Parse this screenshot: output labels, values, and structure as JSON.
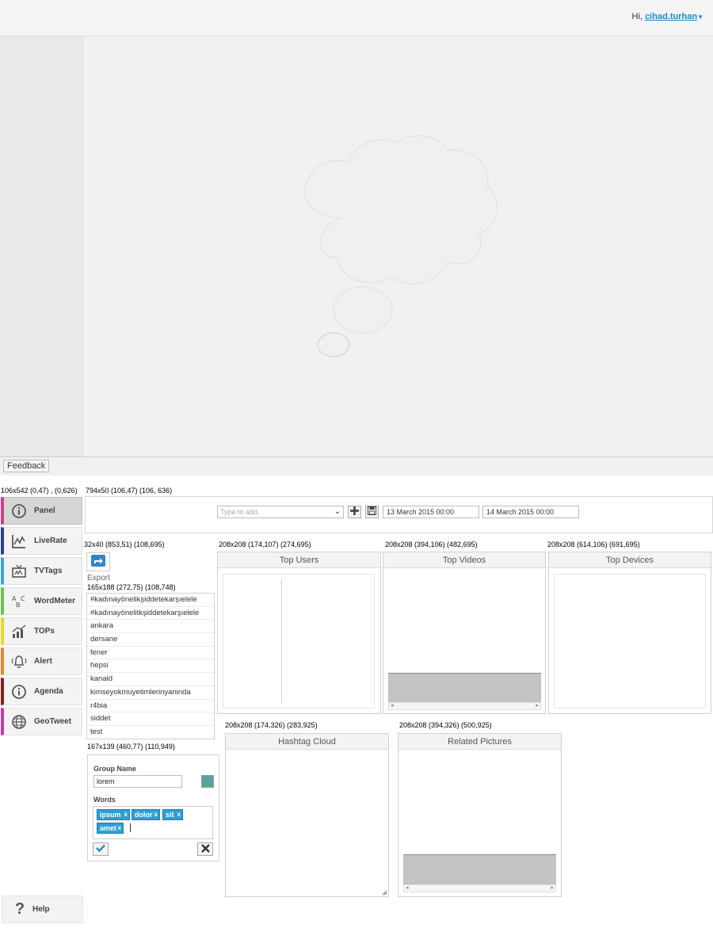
{
  "header": {
    "greeting": "Hi,",
    "username": "cihad.turhan"
  },
  "feedback_label": "Feedback",
  "annotations": {
    "sidebar": "106x542  (0,47) , (0,626)",
    "filterbar": "794x50 (106,47) (106, 636)",
    "export": "32x40 (853,51) (108,695)",
    "top_users": "208x208 (174,107) (274,695)",
    "top_videos": "208x208 (394,106) (482,695)",
    "top_devices": "208x208 (614,106) (691,695)",
    "hashtag_list": "165x188 (272,75) (108,748)",
    "hashtag_cloud": "208x208 (174,326) (283,925)",
    "related_pictures": "208x208 (394,326) (500,925)",
    "group_form": "167x139 (460,77) (110,949)"
  },
  "sidebar": {
    "items": [
      {
        "label": "Panel",
        "icon": "info-circle-icon",
        "color": "#d63c8c"
      },
      {
        "label": "LiveRate",
        "icon": "line-chart-icon",
        "color": "#2c3e8f"
      },
      {
        "label": "TVTags",
        "icon": "tv-icon",
        "color": "#37a8dc"
      },
      {
        "label": "WordMeter",
        "icon": "abc-icon",
        "color": "#6fc04b"
      },
      {
        "label": "TOPs",
        "icon": "bar-chart-icon",
        "color": "#e6d52b"
      },
      {
        "label": "Alert",
        "icon": "bell-icon",
        "color": "#e8872d"
      },
      {
        "label": "Agenda",
        "icon": "info-circle-icon",
        "color": "#8a1d1d"
      },
      {
        "label": "GeoTweet",
        "icon": "globe-icon",
        "color": "#c53a9d"
      }
    ],
    "help_label": "Help"
  },
  "filter": {
    "placeholder": "Type to add.",
    "start_date": "13 March 2015 00:00",
    "end_date": "14 March 2015 00:00"
  },
  "export_label": "Export",
  "hashtags": [
    "#kadınayönelikşiddetekarşıelele",
    "#kadınayönelitkşiddetekarşıelele",
    "ankara",
    "dersane",
    "fener",
    "hepsi",
    "kanald",
    "kimseyokmuyetimlerinyaninda",
    "r4bia",
    "siddet",
    "test"
  ],
  "group": {
    "name_label": "Group Name",
    "name_value": "lorem",
    "swatch_color": "#58a49b",
    "words_label": "Words",
    "words": [
      "ipsum",
      "dolor",
      "sit",
      "amet"
    ]
  },
  "widgets": {
    "top_users": "Top Users",
    "top_videos": "Top Videos",
    "top_devices": "Top Devices",
    "hashtag_cloud": "Hashtag Cloud",
    "related_pictures": "Related Pictures"
  }
}
